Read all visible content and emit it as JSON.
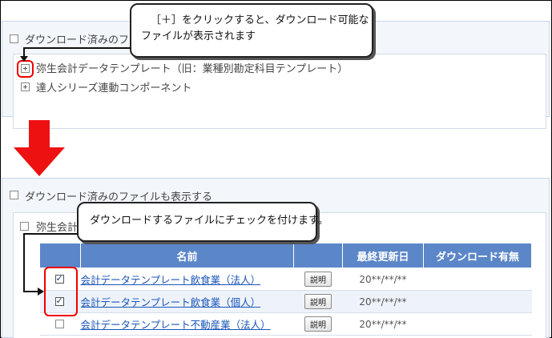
{
  "top_panel": {
    "show_downloaded_label": "ダウンロード済みのファ",
    "tree_items": [
      {
        "label": "弥生会計データテンプレート（旧：業種別勘定科目テンプレート）"
      },
      {
        "label": "達人シリーズ連動コンポーネント"
      }
    ]
  },
  "callout_top": {
    "line1": "［＋］をクリックすると、ダウンロード可能な",
    "line2": "ファイルが表示されます"
  },
  "bottom_panel": {
    "show_downloaded_label": "ダウンロード済みのファイルも表示する",
    "group_label_left": "弥生会計",
    "group_label_right": "）"
  },
  "callout_bottom": {
    "text": "ダウンロードするファイルにチェックを付けます。"
  },
  "table": {
    "headers": [
      "",
      "名前",
      "",
      "最終更新日",
      "ダウンロード有無"
    ],
    "rows": [
      {
        "checked": true,
        "name": "会計データテンプレート飲食業（法人）",
        "button": "説明",
        "date": "20**/**/**",
        "status": ""
      },
      {
        "checked": true,
        "name": "会計データテンプレート飲食業（個人）",
        "button": "説明",
        "date": "20**/**/**",
        "status": ""
      },
      {
        "checked": false,
        "name": "会計データテンプレート不動産業（法人）",
        "button": "説明",
        "date": "20**/**/**",
        "status": ""
      }
    ]
  },
  "colors": {
    "header_bg": "#5b86c8",
    "highlight_red": "#e00000",
    "link_blue": "#1a55b8"
  }
}
